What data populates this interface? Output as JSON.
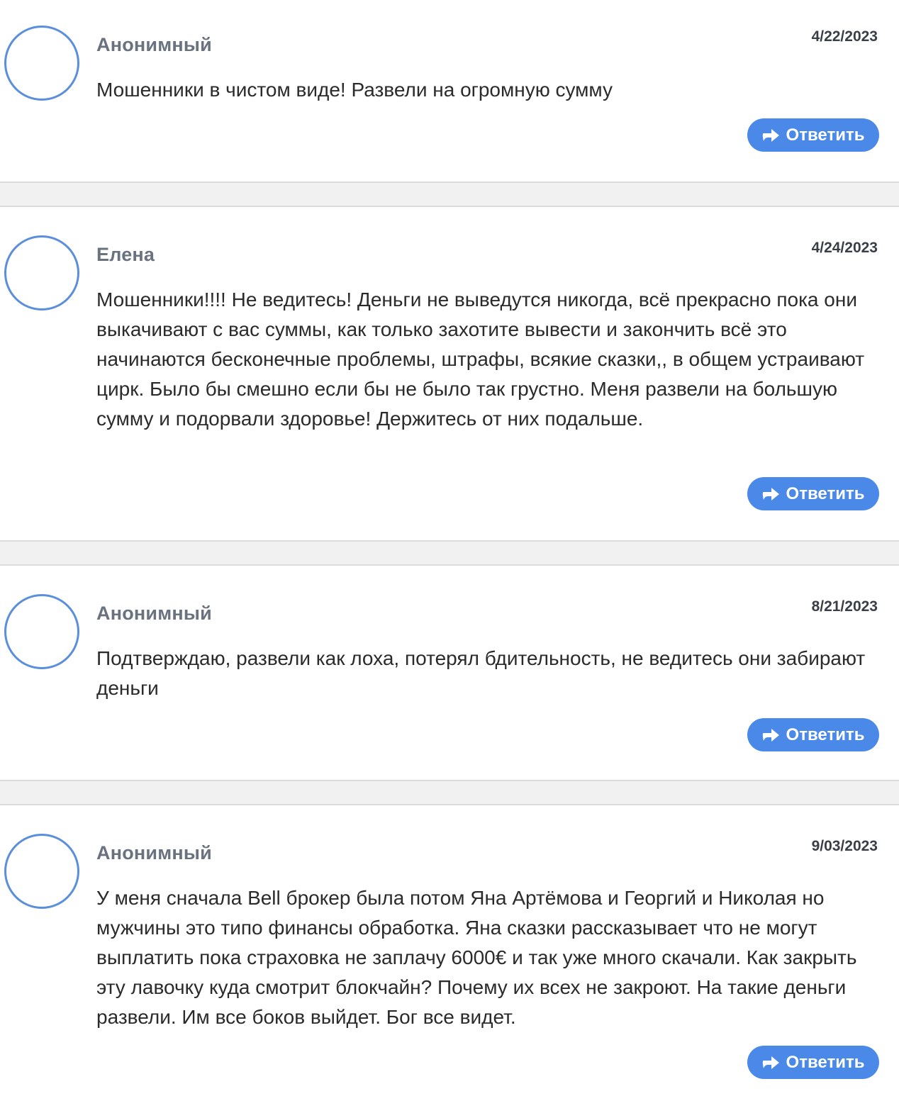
{
  "comments": [
    {
      "author": "Анонимный",
      "date": "4/22/2023",
      "text": "Мошенники в чистом виде! Развели на огромную сумму",
      "reply_label": "Ответить"
    },
    {
      "author": "Елена",
      "date": "4/24/2023",
      "text": "Мошенники!!!! Не ведитесь! Деньги не выведутся никогда, всё прекрасно пока они выкачивают с вас суммы, как только захотите вывести и закончить всё это начинаются бесконечные проблемы, штрафы, всякие сказки,, в общем устраивают цирк. Было бы смешно если бы не было так грустно. Меня развели на большую сумму и подорвали здоровье! Держитесь от них подальше.",
      "reply_label": "Ответить"
    },
    {
      "author": "Анонимный",
      "date": "8/21/2023",
      "text": "Подтверждаю, развели как лоха, потерял бдительность, не ведитесь они забирают деньги",
      "reply_label": "Ответить"
    },
    {
      "author": "Анонимный",
      "date": "9/03/2023",
      "text": "У меня сначала Bell брокер была потом Яна Артёмова и Георгий и Николая но мужчины это типо финансы обработка. Яна сказки рассказывает что не могут выплатить пока страховка не заплачу 6000€ и так уже много скачали. Как закрыть эту лавочку куда смотрит блокчайн? Почему их всех не закроют. На такие деньги развели. Им все боков выйдет. Бог все видет.",
      "reply_label": "Ответить"
    }
  ],
  "icons": {
    "reply": "reply-arrow-icon"
  },
  "colors": {
    "accent": "#4a89e8",
    "avatar_border": "#5b8fdc",
    "separator": "#f1f1f1"
  }
}
